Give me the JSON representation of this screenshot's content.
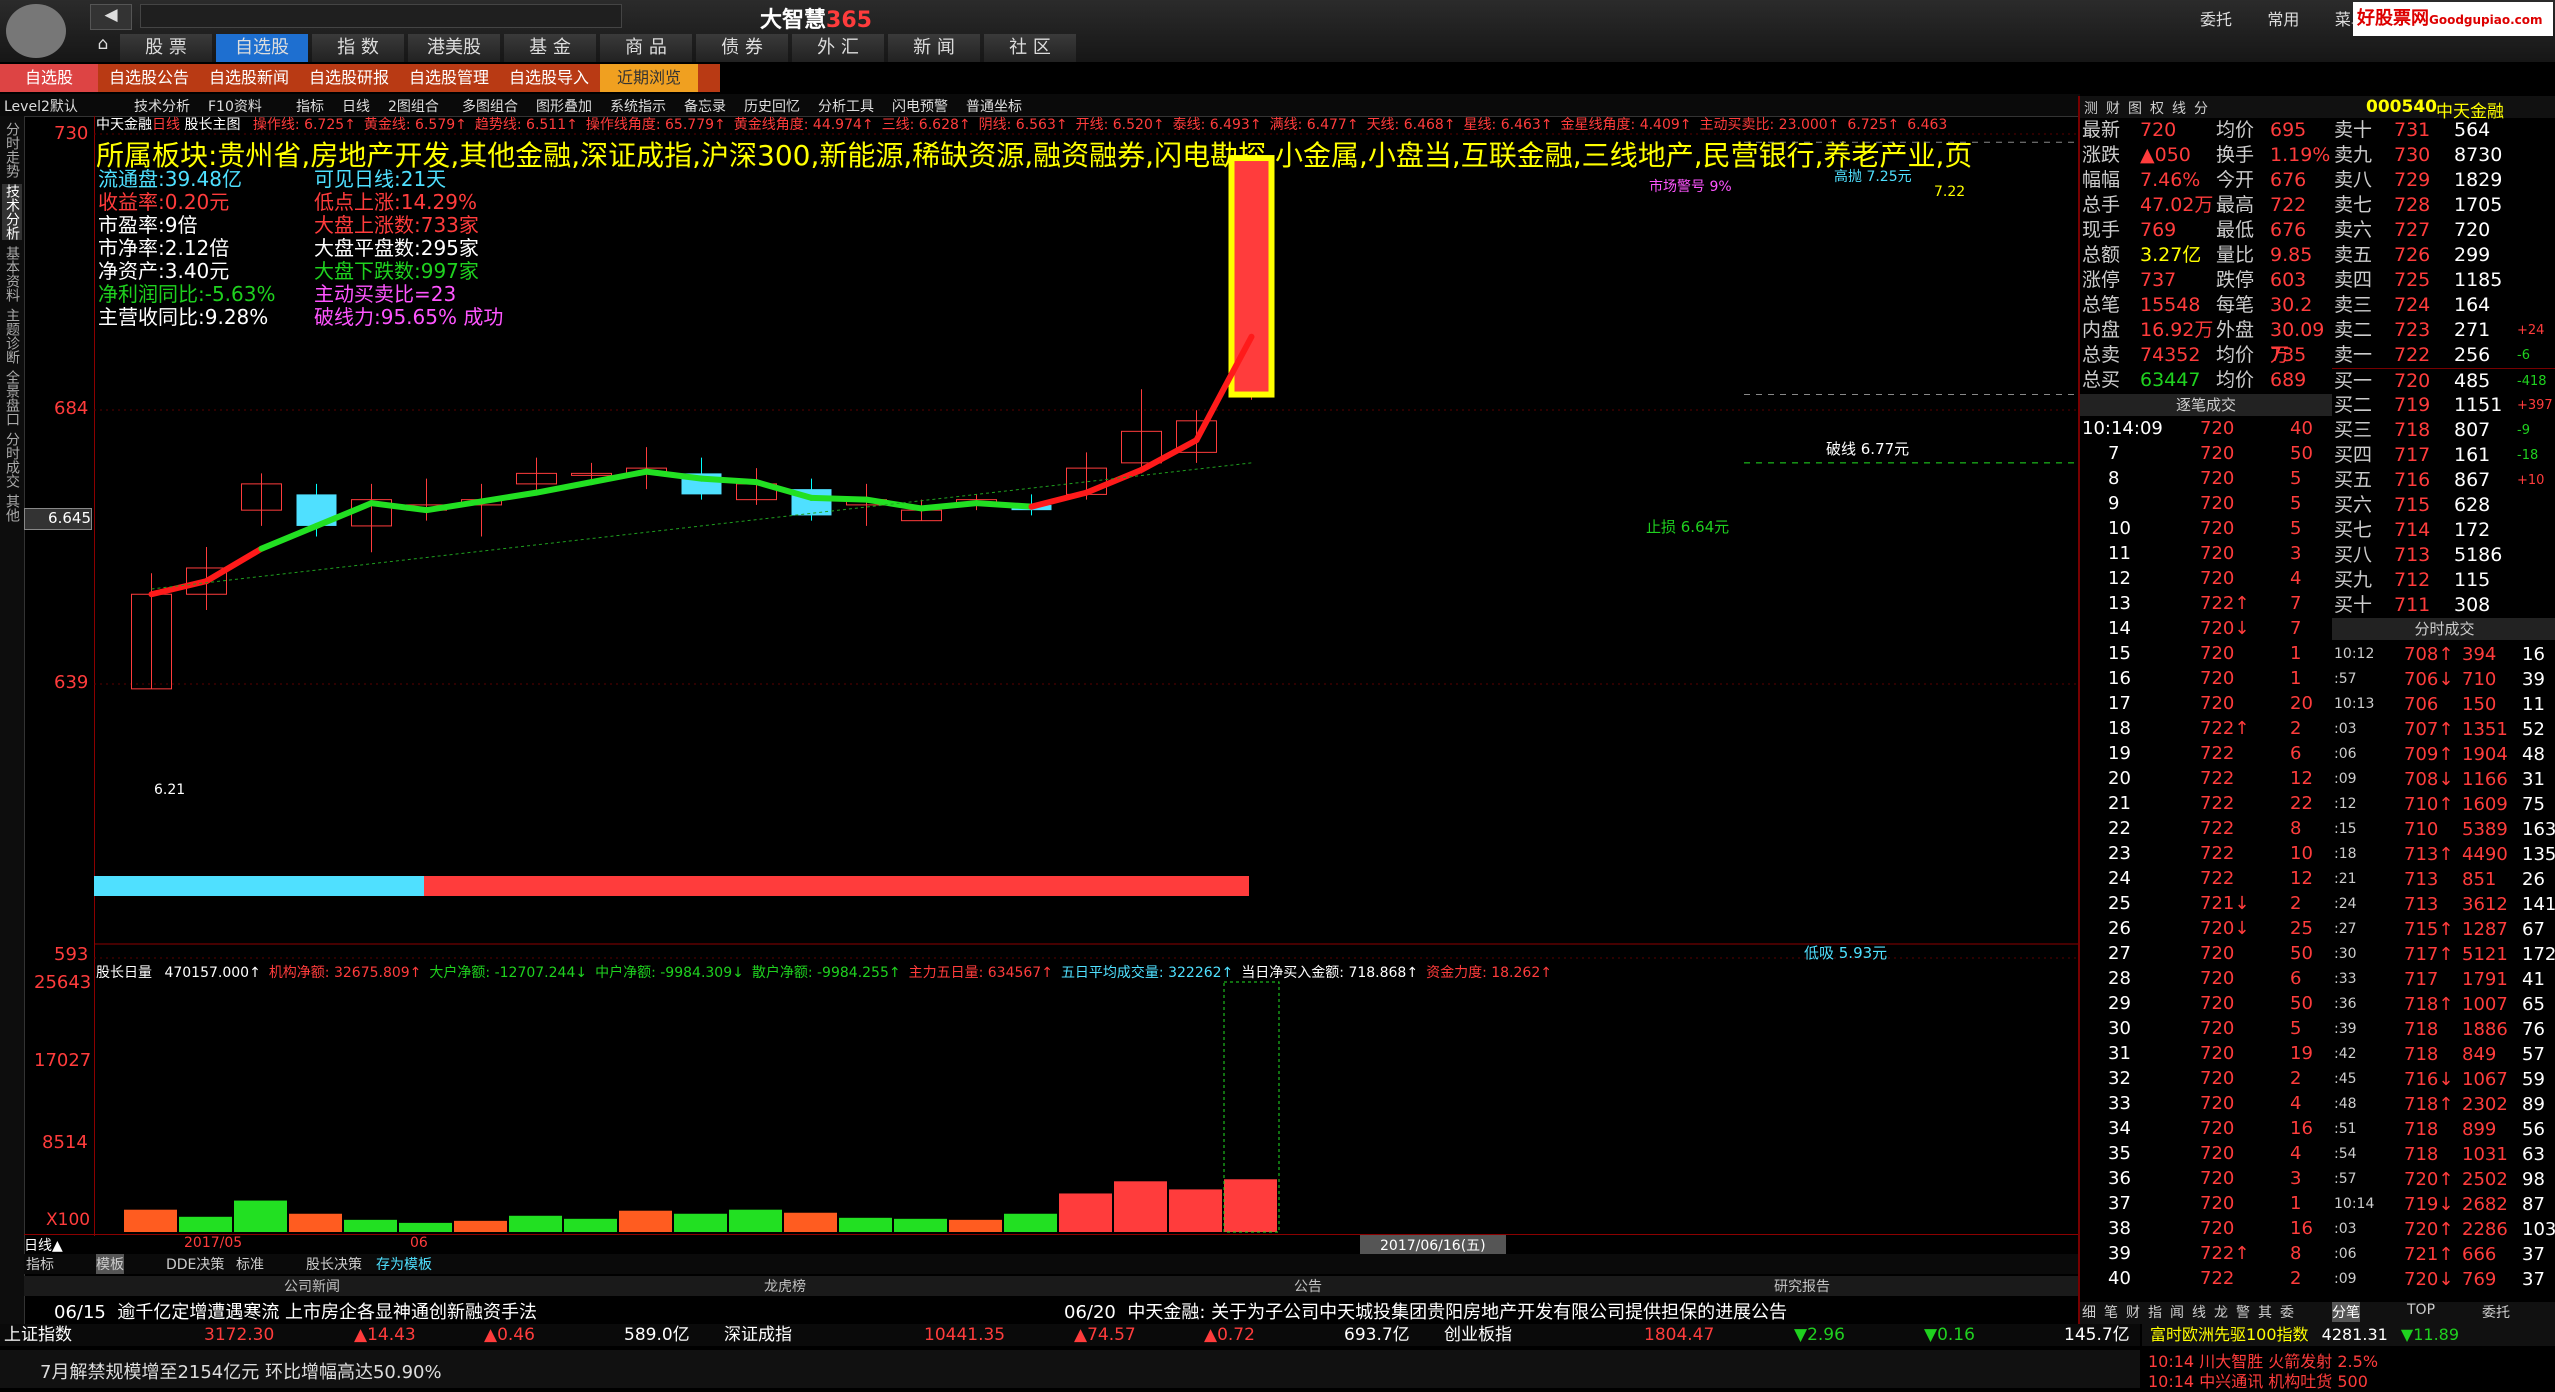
{
  "app": {
    "title_main": "大智慧",
    "title_num": "365",
    "menu": [
      "委托",
      "常用",
      "菜单"
    ],
    "ad": "好股票网",
    "ad_url_text": "Goodgupiao.com"
  },
  "nav": [
    "股 票",
    "自选股",
    "指 数",
    "港美股",
    "基 金",
    "商 品",
    "债 券",
    "外 汇",
    "新 闻",
    "社 区"
  ],
  "subtabs": [
    "自选股",
    "自选股公告",
    "自选股新闻",
    "自选股研报",
    "自选股管理",
    "自选股导入",
    "近期浏览"
  ],
  "toolbar": [
    "Level2默认",
    "技术分析",
    "F10资料",
    "指标",
    "日线",
    "2图组合",
    "多图组合",
    "图形叠加",
    "系统指示",
    "备忘录",
    "历史回忆",
    "分析工具",
    "闪电预警",
    "普通坐标"
  ],
  "chart_header": {
    "stock": "中天金融",
    "period": "日线",
    "name2": "股长主图",
    "items": [
      "操作线: 6.725↑",
      "黄金线: 6.579↑",
      "趋势线: 6.511↑",
      "操作线角度: 65.779↑",
      "黄金线角度: 44.974↑",
      "三线: 6.628↑",
      "阴线: 6.563↑",
      "开线: 6.520↑",
      "泰线: 6.493↑",
      "满线: 6.477↑",
      "天线: 6.468↑",
      "星线: 6.463↑",
      "金星线角度: 4.409↑",
      "主动买卖比: 23.000↑",
      "6.725↑",
      "6.463"
    ]
  },
  "sector": "所属板块:贵州省,房地产开发,其他金融,深证成指,沪深300,新能源,稀缺资源,融资融券,闪电勘探,小金属,小盘当,互联金融,三线地产,民营银行,养老产业,页",
  "info_left": [
    {
      "t": "流通盘:39.48亿",
      "c": "cyan"
    },
    {
      "t": "收益率:0.20元",
      "c": "red"
    },
    {
      "t": "市盈率:9倍",
      "c": "white"
    },
    {
      "t": "市净率:2.12倍",
      "c": "white"
    },
    {
      "t": "净资产:3.40元",
      "c": "white"
    },
    {
      "t": "净利润同比:-5.63%",
      "c": "green"
    },
    {
      "t": "主营收同比:9.28%",
      "c": "white"
    }
  ],
  "info_right": [
    {
      "t": "可见日线:21天",
      "c": "cyan"
    },
    {
      "t": "低点上涨:14.29%",
      "c": "red"
    },
    {
      "t": "大盘上涨数:733家",
      "c": "red"
    },
    {
      "t": "大盘平盘数:295家",
      "c": "white"
    },
    {
      "t": "大盘下跌数:997家",
      "c": "green"
    },
    {
      "t": "主动买卖比=23",
      "c": "mag"
    },
    {
      "t": "破线力:95.65% 成功",
      "c": "mag"
    }
  ],
  "price_axis": [
    "730",
    "684",
    "639",
    "593"
  ],
  "price_box": "6.645",
  "annotations": {
    "market_warn": "市场警号 9%",
    "high_throw": "高抛 7.25元",
    "break_line": "破线 6.77元",
    "stop_loss": "止损 6.64元",
    "low_buy": "低吸 5.93元",
    "low_mark": "6.21",
    "top_mark": "7.22"
  },
  "volume_header": {
    "name": "股长日量",
    "items": [
      {
        "t": "470157.000↑",
        "c": "white"
      },
      {
        "t": "机构净额: 32675.809↑",
        "c": "red"
      },
      {
        "t": "大户净额: -12707.244↓",
        "c": "green"
      },
      {
        "t": "中户净额: -9984.309↓",
        "c": "green"
      },
      {
        "t": "散户净额: -9984.255↑",
        "c": "green"
      },
      {
        "t": "主力五日量: 634567↑",
        "c": "red"
      },
      {
        "t": "五日平均成交量: 322262↑",
        "c": "cyan"
      },
      {
        "t": "当日净买入金额: 718.868↑",
        "c": "white"
      },
      {
        "t": "资金力度: 18.262↑",
        "c": "red"
      }
    ]
  },
  "vol_axis": [
    "25643",
    "17027",
    "8514",
    "X100"
  ],
  "date_axis": {
    "label": "日线▲",
    "d1": "2017/05",
    "d2": "06",
    "current": "2017/06/16(五)"
  },
  "bottom_tabs": [
    "指标",
    "模板",
    "DDE决策",
    "标准",
    "股长决策",
    "存为模板"
  ],
  "news_headers": [
    "公司新闻",
    "龙虎榜",
    "公告",
    "研究报告"
  ],
  "news": {
    "left_date": "06/15",
    "left": "逾千亿定增遭遇寒流 上市房企各显神通创新融资手法",
    "right_date": "06/20",
    "right": "中天金融: 关于为子公司中天城投集团贵阳房地产开发有限公司提供担保的进展公告"
  },
  "index_bar": [
    {
      "n": "上证指数",
      "v": "3172.30",
      "c": "▲14.43",
      "p": "▲0.46",
      "a": "589.0亿"
    },
    {
      "n": "深证成指",
      "v": "10441.35",
      "c": "▲74.57",
      "p": "▲0.72",
      "a": "693.7亿"
    },
    {
      "n": "创业板指",
      "v": "1804.47",
      "c": "▼2.96",
      "p": "▼0.16",
      "a": "145.7亿"
    }
  ],
  "ticker": "7月解禁规模增至2154亿元 环比增幅高达50.90%",
  "rp_header": {
    "tabs": [
      "测",
      "财",
      "图",
      "权",
      "线",
      "分"
    ],
    "code": "000540",
    "name": "中天金融"
  },
  "quote": [
    [
      "最新",
      "720",
      "均价",
      "695"
    ],
    [
      "涨跌",
      "▲050",
      "换手",
      "1.19%"
    ],
    [
      "幅幅",
      "7.46%",
      "今开",
      "676"
    ],
    [
      "总手",
      "47.02万",
      "最高",
      "722"
    ],
    [
      "现手",
      "769",
      "最低",
      "676"
    ],
    [
      "总额",
      "3.27亿",
      "量比",
      "9.85"
    ],
    [
      "涨停",
      "737",
      "跌停",
      "603"
    ],
    [
      "总笔",
      "15548",
      "每笔",
      "30.2"
    ],
    [
      "内盘",
      "16.92万",
      "外盘",
      "30.09万"
    ],
    [
      "总卖",
      "74352",
      "均价",
      "735"
    ],
    [
      "总买",
      "63447",
      "均价",
      "689"
    ]
  ],
  "order_book": [
    [
      "卖十",
      "731",
      "564",
      ""
    ],
    [
      "卖九",
      "730",
      "8730",
      ""
    ],
    [
      "卖八",
      "729",
      "1829",
      ""
    ],
    [
      "卖七",
      "728",
      "1705",
      ""
    ],
    [
      "卖六",
      "727",
      "720",
      ""
    ],
    [
      "卖五",
      "726",
      "299",
      ""
    ],
    [
      "卖四",
      "725",
      "1185",
      ""
    ],
    [
      "卖三",
      "724",
      "164",
      ""
    ],
    [
      "卖二",
      "723",
      "271",
      "+24"
    ],
    [
      "卖一",
      "722",
      "256",
      "-6"
    ],
    [
      "买一",
      "720",
      "485",
      "-418"
    ],
    [
      "买二",
      "719",
      "1151",
      "+397"
    ],
    [
      "买三",
      "718",
      "807",
      "-9"
    ],
    [
      "买四",
      "717",
      "161",
      "-18"
    ],
    [
      "买五",
      "716",
      "867",
      "+10"
    ],
    [
      "买六",
      "715",
      "628",
      ""
    ],
    [
      "买七",
      "714",
      "172",
      ""
    ],
    [
      "买八",
      "713",
      "5186",
      ""
    ],
    [
      "买九",
      "712",
      "115",
      ""
    ],
    [
      "买十",
      "711",
      "308",
      ""
    ]
  ],
  "ticks_label": "逐笔成交",
  "ticks_label2": "分时成交",
  "ticks": [
    [
      "10:14:09",
      "720",
      "40"
    ],
    [
      "7",
      "720",
      "50"
    ],
    [
      "8",
      "720",
      "5"
    ],
    [
      "9",
      "720",
      "5"
    ],
    [
      "10",
      "720",
      "5"
    ],
    [
      "11",
      "720",
      "3"
    ],
    [
      "12",
      "720",
      "4"
    ],
    [
      "13",
      "722↑",
      "7"
    ],
    [
      "14",
      "720↓",
      "7"
    ],
    [
      "15",
      "720",
      "1"
    ],
    [
      "16",
      "720",
      "1"
    ],
    [
      "17",
      "720",
      "20"
    ],
    [
      "18",
      "722↑",
      "2"
    ],
    [
      "19",
      "722",
      "6"
    ],
    [
      "20",
      "722",
      "12"
    ],
    [
      "21",
      "722",
      "22"
    ],
    [
      "22",
      "722",
      "8"
    ],
    [
      "23",
      "722",
      "10"
    ],
    [
      "24",
      "722",
      "12"
    ],
    [
      "25",
      "721↓",
      "2"
    ],
    [
      "26",
      "720↓",
      "25"
    ],
    [
      "27",
      "720",
      "50"
    ],
    [
      "28",
      "720",
      "6"
    ],
    [
      "29",
      "720",
      "50"
    ],
    [
      "30",
      "720",
      "5"
    ],
    [
      "31",
      "720",
      "19"
    ],
    [
      "32",
      "720",
      "2"
    ],
    [
      "33",
      "720",
      "4"
    ],
    [
      "34",
      "720",
      "16"
    ],
    [
      "35",
      "720",
      "4"
    ],
    [
      "36",
      "720",
      "3"
    ],
    [
      "37",
      "720",
      "1"
    ],
    [
      "38",
      "720",
      "16"
    ],
    [
      "39",
      "722↑",
      "8"
    ],
    [
      "40",
      "722",
      "2"
    ]
  ],
  "min_ticks": [
    [
      "10:12",
      "708↑",
      "394",
      "16"
    ],
    [
      ":57",
      "706↓",
      "710",
      "39"
    ],
    [
      "10:13",
      "706",
      "150",
      "11"
    ],
    [
      ":03",
      "707↑",
      "1351",
      "52"
    ],
    [
      ":06",
      "709↑",
      "1904",
      "48"
    ],
    [
      ":09",
      "708↓",
      "1166",
      "31"
    ],
    [
      ":12",
      "710↑",
      "1609",
      "75"
    ],
    [
      ":15",
      "710",
      "5389",
      "163"
    ],
    [
      ":18",
      "713↑",
      "4490",
      "135"
    ],
    [
      ":21",
      "713",
      "851",
      "26"
    ],
    [
      ":24",
      "713",
      "3612",
      "141"
    ],
    [
      ":27",
      "715↑",
      "1287",
      "67"
    ],
    [
      ":30",
      "717↑",
      "5121",
      "172"
    ],
    [
      ":33",
      "717",
      "1791",
      "41"
    ],
    [
      ":36",
      "718↑",
      "1007",
      "65"
    ],
    [
      ":39",
      "718",
      "1886",
      "76"
    ],
    [
      ":42",
      "718",
      "849",
      "57"
    ],
    [
      ":45",
      "716↓",
      "1067",
      "59"
    ],
    [
      ":48",
      "718↑",
      "2302",
      "89"
    ],
    [
      ":51",
      "718",
      "899",
      "56"
    ],
    [
      ":54",
      "718",
      "1031",
      "63"
    ],
    [
      ":57",
      "720↑",
      "2502",
      "98"
    ],
    [
      "10:14",
      "719↓",
      "2682",
      "87"
    ],
    [
      ":03",
      "720↑",
      "2286",
      "103"
    ],
    [
      ":06",
      "721↑",
      "666",
      "37"
    ],
    [
      ":09",
      "720↓",
      "769",
      "37"
    ]
  ],
  "rp_bottom_tabs": [
    "细",
    "笔",
    "财",
    "指",
    "闻",
    "线",
    "龙",
    "警",
    "其",
    "委"
  ],
  "rp_bottom_tabs2": [
    "分笔",
    "TOP",
    "委托"
  ],
  "rb_ticker": {
    "n": "富时欧洲先驱100指数",
    "v": "4281.31",
    "c": "▼11.89"
  },
  "rb_news": [
    "10:14 川大智胜 火箭发射 2.5%",
    "10:14 中兴通讯 机构吐货 500"
  ],
  "candles": [
    {
      "o": 6.21,
      "c": 6.39,
      "h": 6.43,
      "l": 6.21,
      "u": 1
    },
    {
      "o": 6.39,
      "c": 6.44,
      "h": 6.48,
      "l": 6.36,
      "u": 1
    },
    {
      "o": 6.55,
      "c": 6.6,
      "h": 6.62,
      "l": 6.52,
      "u": 1
    },
    {
      "o": 6.58,
      "c": 6.52,
      "h": 6.6,
      "l": 6.5,
      "u": 0
    },
    {
      "o": 6.52,
      "c": 6.57,
      "h": 6.6,
      "l": 6.47,
      "u": 1
    },
    {
      "o": 6.55,
      "c": 6.56,
      "h": 6.61,
      "l": 6.53,
      "u": 1
    },
    {
      "o": 6.56,
      "c": 6.57,
      "h": 6.6,
      "l": 6.5,
      "u": 1
    },
    {
      "o": 6.6,
      "c": 6.62,
      "h": 6.65,
      "l": 6.58,
      "u": 1
    },
    {
      "o": 6.62,
      "c": 6.62,
      "h": 6.64,
      "l": 6.6,
      "u": 1
    },
    {
      "o": 6.62,
      "c": 6.63,
      "h": 6.67,
      "l": 6.59,
      "u": 1
    },
    {
      "o": 6.62,
      "c": 6.58,
      "h": 6.65,
      "l": 6.57,
      "u": 0
    },
    {
      "o": 6.57,
      "c": 6.6,
      "h": 6.63,
      "l": 6.56,
      "u": 1
    },
    {
      "o": 6.59,
      "c": 6.54,
      "h": 6.61,
      "l": 6.53,
      "u": 0
    },
    {
      "o": 6.56,
      "c": 6.57,
      "h": 6.6,
      "l": 6.52,
      "u": 1
    },
    {
      "o": 6.53,
      "c": 6.55,
      "h": 6.57,
      "l": 6.53,
      "u": 1
    },
    {
      "o": 6.56,
      "c": 6.57,
      "h": 6.58,
      "l": 6.55,
      "u": 1
    },
    {
      "o": 6.56,
      "c": 6.55,
      "h": 6.58,
      "l": 6.54,
      "u": 0
    },
    {
      "o": 6.58,
      "c": 6.63,
      "h": 6.66,
      "l": 6.57,
      "u": 1
    },
    {
      "o": 6.64,
      "c": 6.7,
      "h": 6.78,
      "l": 6.62,
      "u": 1
    },
    {
      "o": 6.66,
      "c": 6.72,
      "h": 6.74,
      "l": 6.64,
      "u": 1
    },
    {
      "o": 6.77,
      "c": 7.22,
      "h": 7.22,
      "l": 6.76,
      "u": 1
    }
  ],
  "vols": [
    2200,
    1500,
    3100,
    1800,
    1200,
    900,
    1100,
    1600,
    1300,
    2100,
    1800,
    2200,
    1900,
    1400,
    1300,
    1200,
    1800,
    3800,
    5000,
    4200,
    5200
  ],
  "colors": {
    "up": "#ff3c3c",
    "down": "#00ffff",
    "ma": "#ff0000",
    "ma2": "#22e022",
    "bg": "#000000",
    "accent": "#b93a14"
  }
}
